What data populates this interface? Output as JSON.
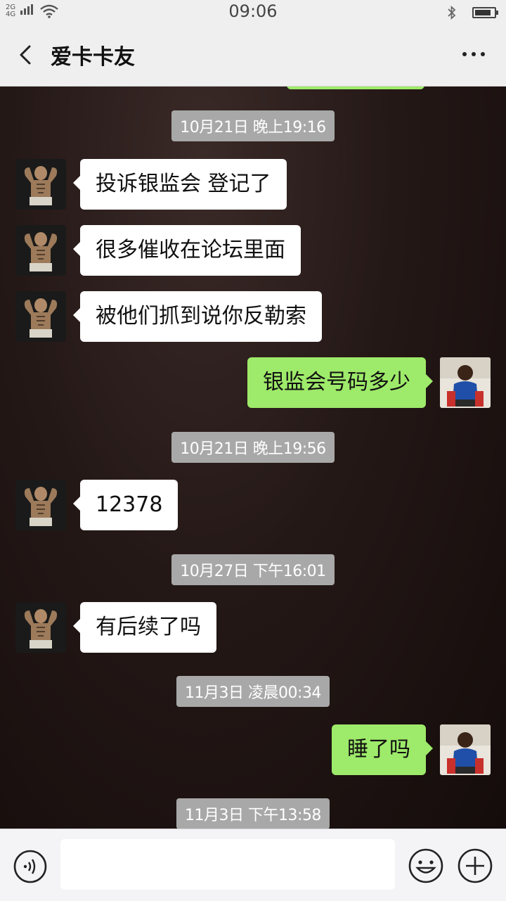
{
  "status_bar": {
    "network_top": "2G",
    "network_bottom": "4G",
    "time": "09:06"
  },
  "header": {
    "title": "爱卡卡友"
  },
  "messages": [
    {
      "type": "time",
      "text": "10月21日 晚上19:16"
    },
    {
      "type": "in",
      "text": "投诉银监会 登记了"
    },
    {
      "type": "in",
      "text": "很多催收在论坛里面"
    },
    {
      "type": "in",
      "text": "被他们抓到说你反勒索"
    },
    {
      "type": "out",
      "text": "银监会号码多少"
    },
    {
      "type": "time",
      "text": "10月21日 晚上19:56"
    },
    {
      "type": "in",
      "text": "12378"
    },
    {
      "type": "time",
      "text": "10月27日 下午16:01"
    },
    {
      "type": "in",
      "text": "有后续了吗"
    },
    {
      "type": "time",
      "text": "11月3日 凌晨00:34"
    },
    {
      "type": "out",
      "text": "睡了吗"
    },
    {
      "type": "time",
      "text": "11月3日 下午13:58"
    }
  ],
  "input_bar": {
    "value": "",
    "placeholder": ""
  },
  "colors": {
    "outgoing_bubble": "#9eea6a",
    "incoming_bubble": "#ffffff",
    "timestamp_bg": "#a8a8a8"
  },
  "icons": {
    "back": "chevron-left-icon",
    "more": "more-dots-icon",
    "voice": "voice-icon",
    "emoji": "emoji-icon",
    "plus": "plus-icon",
    "bluetooth": "bluetooth-icon",
    "wifi": "wifi-icon",
    "battery": "battery-icon"
  }
}
